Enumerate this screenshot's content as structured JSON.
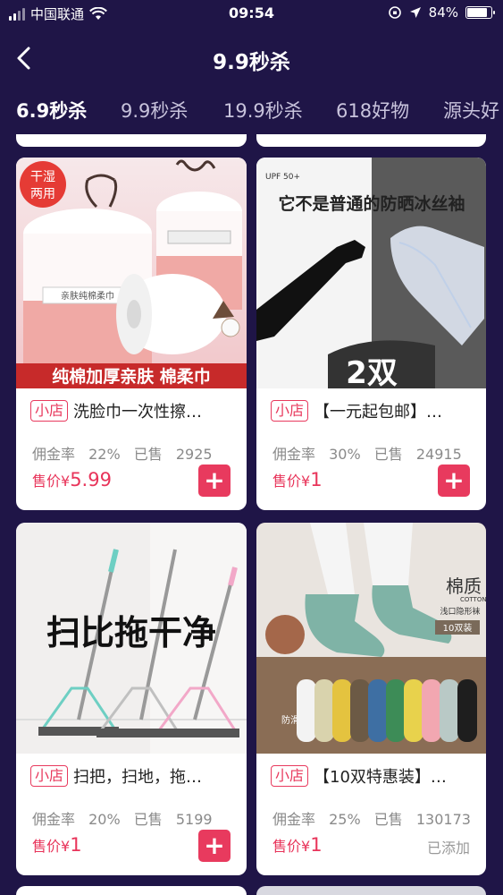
{
  "status_bar": {
    "carrier": "中国联通",
    "time": "09:54",
    "battery": "84%",
    "battery_level": 0.84
  },
  "header": {
    "title": "9.9秒杀"
  },
  "tabs": [
    {
      "label": "6.9秒杀",
      "active": true
    },
    {
      "label": "9.9秒杀"
    },
    {
      "label": "19.9秒杀"
    },
    {
      "label": "618好物"
    },
    {
      "label": "源头好"
    }
  ],
  "products": [
    {
      "tag": "小店",
      "name": "洗脸巾一次性擦…",
      "commission_label": "佣金率",
      "commission": "22%",
      "sold_label": "已售",
      "sold": "2925",
      "price_label": "售价¥",
      "price": "5.99",
      "action": "add",
      "image_text": {
        "badge": "干湿两用",
        "banner": "纯棉加厚亲肤 棉柔巾",
        "package": "亲肤纯棉柔巾"
      }
    },
    {
      "tag": "小店",
      "name": "【一元起包邮】…",
      "commission_label": "佣金率",
      "commission": "30%",
      "sold_label": "已售",
      "sold": "24915",
      "price_label": "售价¥",
      "price": "1",
      "action": "add",
      "image_text": {
        "headline": "它不是普通的防晒冰丝袖",
        "badge": "2双",
        "upf": "UPF 50+"
      }
    },
    {
      "tag": "小店",
      "name": "扫把，扫地，拖…",
      "commission_label": "佣金率",
      "commission": "20%",
      "sold_label": "已售",
      "sold": "5199",
      "price_label": "售价¥",
      "price": "1",
      "action": "add",
      "image_text": {
        "headline": "扫比拖干净"
      }
    },
    {
      "tag": "小店",
      "name": "【10双特惠装】…",
      "commission_label": "佣金率",
      "commission": "25%",
      "sold_label": "已售",
      "sold": "130173",
      "price_label": "售价¥",
      "price": "1",
      "action": "added",
      "added_label": "已添加",
      "image_text": {
        "brand": "棉质",
        "brand_en": "COTTON",
        "subtitle": "浅口隐形袜",
        "pack": "10双装",
        "note": "防滑硅胶"
      }
    }
  ],
  "colors": {
    "background": "#1f1547",
    "accent": "#e83a5e",
    "tab_underline": "#f1b35a"
  }
}
